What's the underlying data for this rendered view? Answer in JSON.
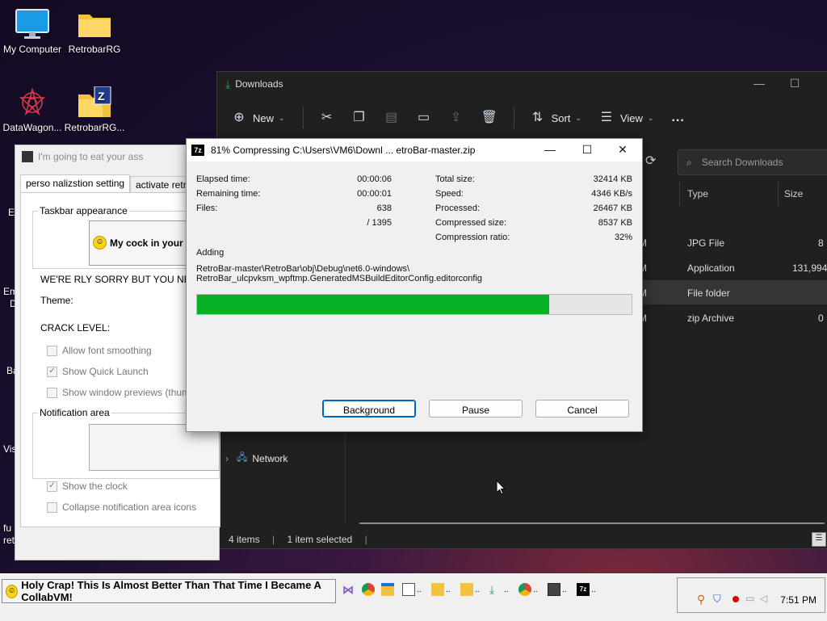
{
  "desktop": {
    "icons": [
      {
        "label": "My Computer",
        "icon": "monitor-icon"
      },
      {
        "label": "RetrobarRG",
        "icon": "folder-icon"
      },
      {
        "label": "DataWagon...",
        "icon": "datawagon-icon"
      },
      {
        "label": "RetrobarRG...",
        "icon": "zip-folder-icon"
      }
    ],
    "edge_labels": [
      "E",
      "Em",
      "D",
      "Ba",
      "Vis",
      "fu",
      "ret"
    ]
  },
  "explorer": {
    "title": "Downloads",
    "toolbar": {
      "new": "New",
      "sort": "Sort",
      "view": "View",
      "more": "..."
    },
    "search_placeholder": "Search Downloads",
    "columns": {
      "type": "Type",
      "size": "Size"
    },
    "rows": [
      {
        "date_tail": "M",
        "type": "JPG File",
        "size": "8"
      },
      {
        "date_tail": "M",
        "type": "Application",
        "size": "131,994"
      },
      {
        "date_tail": "M",
        "type": "File folder",
        "size": ""
      },
      {
        "date_tail": "M",
        "type": "zip Archive",
        "size": "0"
      }
    ],
    "selected_row": 2,
    "nav_network": "Network",
    "status": {
      "items": "4 items",
      "selected": "1 item selected"
    }
  },
  "props": {
    "title": "I'm going to eat your ass",
    "tabs": [
      "perso nalizstion setting",
      "activate retr"
    ],
    "taskbar_group": "Taskbar appearance",
    "preview_text": "My cock in your as",
    "sorry_text": "WE'RE RLY SORRY BUT YOU NEED",
    "theme_label": "Theme:",
    "crack_label": "CRACK LEVEL:",
    "checks": [
      {
        "label": "Allow font smoothing",
        "checked": false
      },
      {
        "label": "Show Quick Launch",
        "checked": true
      },
      {
        "label": "Show window previews (thuml",
        "checked": false
      }
    ],
    "notif_group": "Notification area",
    "notif_checks": [
      {
        "label": "Show the clock",
        "checked": true
      },
      {
        "label": "Collapse notification area icons",
        "checked": false
      }
    ]
  },
  "zip": {
    "title": "81% Compressing C:\\Users\\VM6\\Downl ... etroBar-master.zip",
    "left_stats": [
      {
        "label": "Elapsed time:",
        "value": "00:00:06"
      },
      {
        "label": "Remaining time:",
        "value": "00:00:01"
      },
      {
        "label": "Files:",
        "value": "638"
      },
      {
        "label": "",
        "value": "/ 1395"
      }
    ],
    "right_stats": [
      {
        "label": "Total size:",
        "value": "32414 KB"
      },
      {
        "label": "Speed:",
        "value": "4346 KB/s"
      },
      {
        "label": "Processed:",
        "value": "26467 KB"
      },
      {
        "label": "Compressed size:",
        "value": "8537 KB"
      },
      {
        "label": "Compression ratio:",
        "value": "32%"
      }
    ],
    "adding_label": "Adding",
    "path_line1": "RetroBar-master\\RetroBar\\obj\\Debug\\net6.0-windows\\",
    "path_line2": "RetroBar_ulcpvksm_wpftmp.GeneratedMSBuildEditorConfig.editorconfig",
    "progress": 0.81,
    "buttons": {
      "background": "Background",
      "pause": "Pause",
      "cancel": "Cancel"
    }
  },
  "taskbar": {
    "start_text": "Holy Crap! This Is Almost Better Than That Time I Became A CollabVM!",
    "clock": "7:51 PM",
    "apps": [
      {
        "icon": "visual-studio-icon",
        "label": ""
      },
      {
        "icon": "chrome-icon",
        "label": ""
      },
      {
        "icon": "explorer-icon",
        "label": ""
      },
      {
        "icon": "notepad-icon",
        "label": ".."
      },
      {
        "icon": "folder-icon",
        "label": ".."
      },
      {
        "icon": "folder-icon",
        "label": ".."
      },
      {
        "icon": "download-icon",
        "label": ".."
      },
      {
        "icon": "chrome-icon",
        "label": ".."
      },
      {
        "icon": "app-icon",
        "label": ".."
      },
      {
        "icon": "7zip-icon",
        "label": ".."
      }
    ]
  }
}
